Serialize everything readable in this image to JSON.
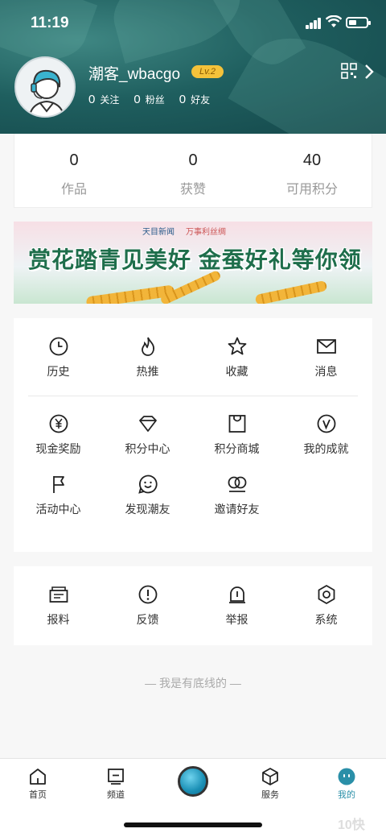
{
  "status_bar": {
    "time": "11:19"
  },
  "profile": {
    "username": "潮客_wbacgo",
    "level": "Lv.2",
    "follow_count": "0",
    "follow_label": "关注",
    "fans_count": "0",
    "fans_label": "粉丝",
    "friends_count": "0",
    "friends_label": "好友"
  },
  "stats": [
    {
      "value": "0",
      "label": "作品"
    },
    {
      "value": "0",
      "label": "获赞"
    },
    {
      "value": "40",
      "label": "可用积分"
    }
  ],
  "banner": {
    "brand1": "天目新闻",
    "brand2": "万事利丝绸",
    "headline": "赏花踏青见美好 金蚕好礼等你领"
  },
  "menu_primary": [
    {
      "label": "历史",
      "icon": "clock-icon"
    },
    {
      "label": "热推",
      "icon": "flame-icon"
    },
    {
      "label": "收藏",
      "icon": "star-icon"
    },
    {
      "label": "消息",
      "icon": "mail-icon"
    }
  ],
  "menu_secondary": [
    {
      "label": "现金奖励",
      "icon": "yuan-icon"
    },
    {
      "label": "积分中心",
      "icon": "diamond-icon"
    },
    {
      "label": "积分商城",
      "icon": "shopping-bag-icon"
    },
    {
      "label": "我的成就",
      "icon": "achievement-icon"
    },
    {
      "label": "活动中心",
      "icon": "flag-icon"
    },
    {
      "label": "发现潮友",
      "icon": "smile-icon"
    },
    {
      "label": "邀请好友",
      "icon": "invite-icon"
    }
  ],
  "menu_tools": [
    {
      "label": "报料",
      "icon": "report-tip-icon"
    },
    {
      "label": "反馈",
      "icon": "feedback-icon"
    },
    {
      "label": "举报",
      "icon": "alarm-icon"
    },
    {
      "label": "系统",
      "icon": "settings-hexagon-icon"
    }
  ],
  "footer_text": "— 我是有底线的 —",
  "tabbar": [
    {
      "label": "首页",
      "icon": "home-icon"
    },
    {
      "label": "频道",
      "icon": "channel-icon"
    },
    {
      "label": "服务",
      "icon": "service-cube-icon"
    },
    {
      "label": "我的",
      "icon": "profile-face-icon",
      "active": true
    }
  ],
  "watermark": "10快",
  "colors": {
    "header": "#1f5f5f",
    "accent": "#2a8fa8",
    "level_badge": "#f4c23a"
  }
}
